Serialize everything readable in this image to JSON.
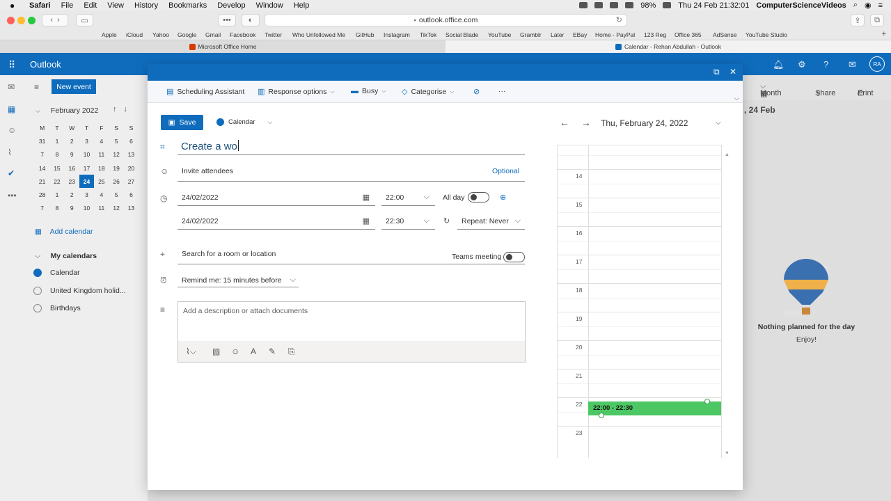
{
  "mac_menubar": {
    "apple": "",
    "items": [
      "Safari",
      "File",
      "Edit",
      "View",
      "History",
      "Bookmarks",
      "Develop",
      "Window",
      "Help"
    ],
    "battery": "98%",
    "clock": "Thu 24 Feb  21:32:01",
    "user": "ComputerScienceVideos"
  },
  "safari": {
    "url": "outlook.office.com",
    "favorites": [
      "Apple",
      "iCloud",
      "Yahoo",
      "Google",
      "Gmail",
      "Facebook",
      "Twitter",
      "Who Unfollowed Me",
      "GitHub",
      "Instagram",
      "TikTok",
      "Social Blade",
      "YouTube",
      "Gramblr",
      "Later",
      "EBay",
      "Home - PayPal",
      "123 Reg",
      "Office 365",
      "AdSense",
      "YouTube Studio"
    ],
    "tabs": [
      {
        "label": "Microsoft Office Home",
        "color": "#d83b01"
      },
      {
        "label": "Calendar - Rehan Abdullah - Outlook",
        "color": "#0f6cbd"
      }
    ]
  },
  "outlook": {
    "brand": "Outlook",
    "avatar": "RA",
    "new_event": "New event",
    "month_title": "February 2022",
    "weekdays": [
      "M",
      "T",
      "W",
      "T",
      "F",
      "S",
      "S"
    ],
    "days": [
      "31",
      "1",
      "2",
      "3",
      "4",
      "5",
      "6",
      "7",
      "8",
      "9",
      "10",
      "11",
      "12",
      "13",
      "14",
      "15",
      "16",
      "17",
      "18",
      "19",
      "20",
      "21",
      "22",
      "23",
      "24",
      "25",
      "26",
      "27",
      "28",
      "1",
      "2",
      "3",
      "4",
      "5",
      "6",
      "7",
      "8",
      "9",
      "10",
      "11",
      "12",
      "13"
    ],
    "today": "24",
    "add_calendar": "Add calendar",
    "my_calendars": "My calendars",
    "calendars": [
      {
        "label": "Calendar",
        "checked": true
      },
      {
        "label": "United Kingdom holid...",
        "checked": false
      },
      {
        "label": "Birthdays",
        "checked": false
      }
    ],
    "view_month": "Month",
    "share": "Share",
    "print": "Print",
    "right_date": ", 24 Feb",
    "nothing_planned": "Nothing planned for the day",
    "enjoy": "Enjoy!"
  },
  "dialog": {
    "commands": [
      {
        "label": "Scheduling Assistant",
        "icon": "scheduling-icon"
      },
      {
        "label": "Response options",
        "icon": "response-icon"
      },
      {
        "label": "Busy",
        "icon": "busy-icon"
      },
      {
        "label": "Categorise",
        "icon": "tag-icon"
      }
    ],
    "save": "Save",
    "calendar_select": "Calendar",
    "title_value": "Create a wo",
    "invite_placeholder": "Invite attendees",
    "optional": "Optional",
    "start_date": "24/02/2022",
    "start_time": "22:00",
    "all_day": "All day",
    "end_date": "24/02/2022",
    "end_time": "22:30",
    "repeat": "Repeat: Never",
    "location_placeholder": "Search for a room or location",
    "teams_meeting": "Teams meeting",
    "remind": "Remind me: 15 minutes before",
    "description_placeholder": "Add a description or attach documents",
    "day_date": "Thu, February 24, 2022",
    "hours": [
      "14",
      "15",
      "16",
      "17",
      "18",
      "19",
      "20",
      "21",
      "22",
      "23"
    ],
    "event_label": "22:00 - 22:30",
    "event_color": "#4cc764"
  }
}
